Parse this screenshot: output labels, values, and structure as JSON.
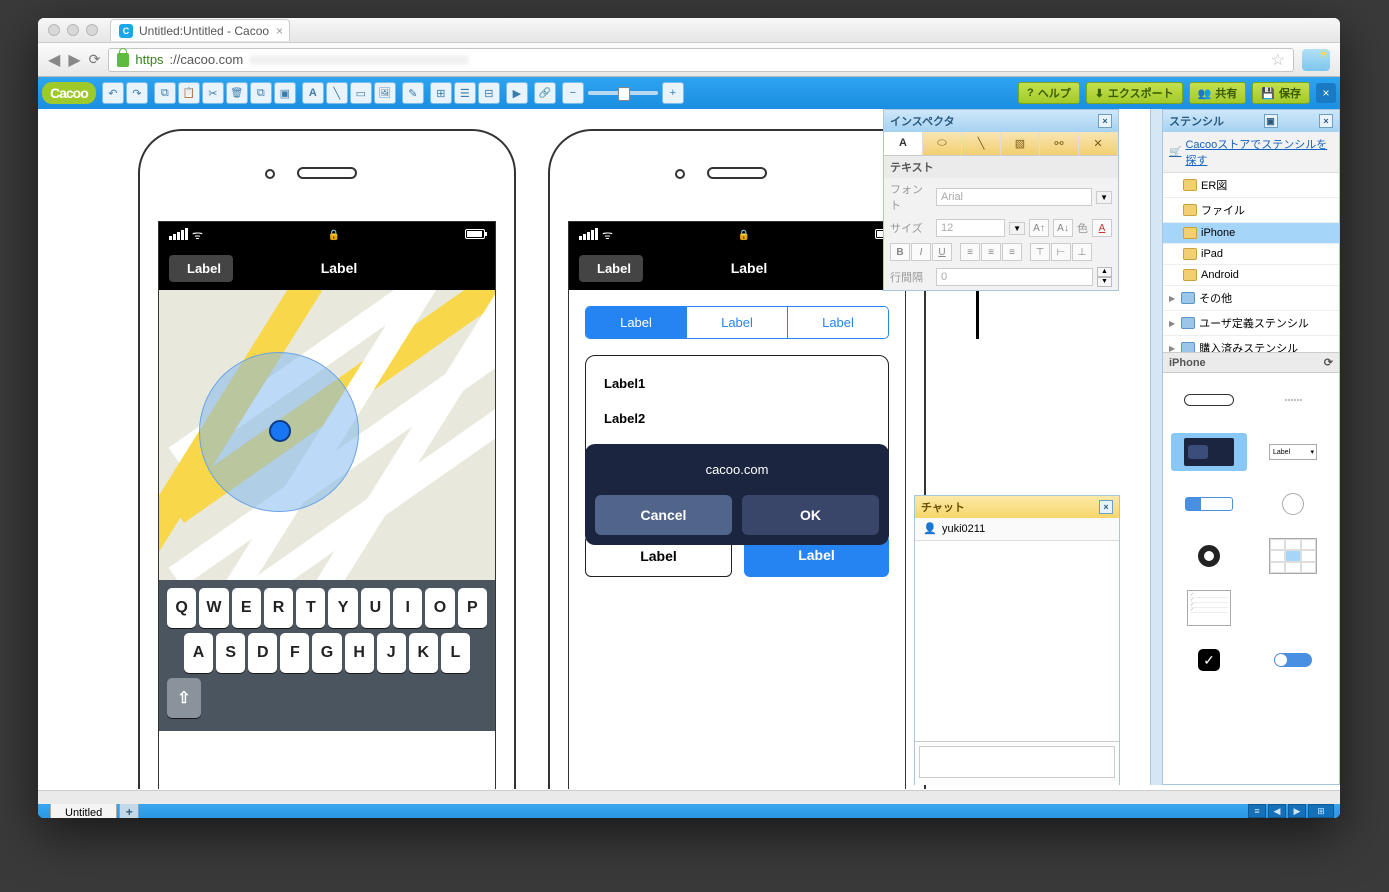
{
  "browser": {
    "tab_title": "Untitled:Untitled - Cacoo",
    "url_scheme": "https",
    "url_host": "://cacoo.com"
  },
  "toolbar": {
    "logo": "Cacoo",
    "help": "ヘルプ",
    "export": "エクスポート",
    "share": "共有",
    "save": "保存"
  },
  "inspector": {
    "title": "インスペクタ",
    "section_text": "テキスト",
    "font_label": "フォント",
    "font_value": "Arial",
    "size_label": "サイズ",
    "size_value": "12",
    "color_label": "色",
    "line_spacing_label": "行間隔",
    "line_spacing_value": "0"
  },
  "stencil": {
    "title": "ステンシル",
    "store_link": "Cacooストアでステンシルを探す",
    "cats": [
      {
        "label": "ER図",
        "type": "doc"
      },
      {
        "label": "ファイル",
        "type": "doc"
      },
      {
        "label": "iPhone",
        "type": "doc",
        "selected": true
      },
      {
        "label": "iPad",
        "type": "doc"
      },
      {
        "label": "Android",
        "type": "doc"
      },
      {
        "label": "その他",
        "type": "folder",
        "expand": true
      },
      {
        "label": "ユーザ定義ステンシル",
        "type": "folder",
        "expand": true
      },
      {
        "label": "購入済みステンシル",
        "type": "folder",
        "expand": true
      }
    ],
    "preview_title": "iPhone",
    "dropdown_label": "Label"
  },
  "chat": {
    "title": "チャット",
    "user": "yuki0211"
  },
  "phone_left": {
    "back": "Label",
    "title": "Label",
    "keys_row1": [
      "Q",
      "W",
      "E",
      "R",
      "T",
      "Y",
      "U",
      "I",
      "O",
      "P"
    ],
    "keys_row2": [
      "A",
      "S",
      "D",
      "F",
      "G",
      "H",
      "J",
      "K",
      "L"
    ]
  },
  "phone_right": {
    "back": "Label",
    "title": "Label",
    "tabs": [
      "Label",
      "Label",
      "Label"
    ],
    "list": [
      "Label1",
      "Label2"
    ],
    "btn_outline": "Label",
    "btn_primary": "Label",
    "dialog_text": "cacoo.com",
    "dialog_cancel": "Cancel",
    "dialog_ok": "OK"
  },
  "sheet": {
    "tab": "Untitled"
  }
}
